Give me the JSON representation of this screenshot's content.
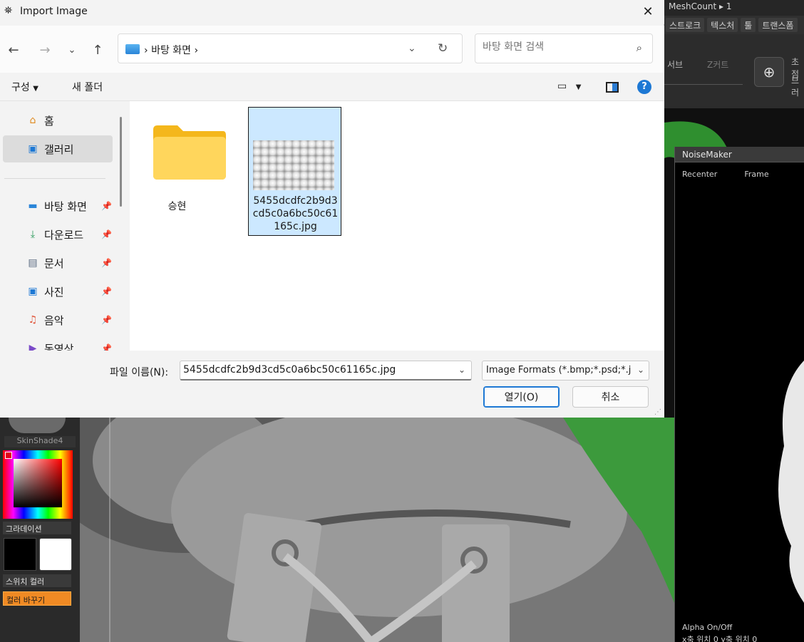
{
  "dialog": {
    "title": "Import Image",
    "address": {
      "path": "바탕 화면"
    },
    "search": {
      "placeholder": "바탕 화면 검색"
    },
    "commandbar": {
      "organize": "구성",
      "new_folder": "새 폴더"
    },
    "sidebar": {
      "top_items": [
        {
          "label": "홈",
          "icon": "home-icon"
        },
        {
          "label": "갤러리",
          "icon": "gallery-icon"
        }
      ],
      "pinned_items": [
        {
          "label": "바탕 화면",
          "icon": "desktop-icon"
        },
        {
          "label": "다운로드",
          "icon": "download-icon"
        },
        {
          "label": "문서",
          "icon": "document-icon"
        },
        {
          "label": "사진",
          "icon": "pictures-icon"
        },
        {
          "label": "음악",
          "icon": "music-icon"
        },
        {
          "label": "동영상",
          "icon": "video-icon"
        }
      ]
    },
    "files": [
      {
        "name": "승현",
        "type": "folder"
      },
      {
        "name": "5455dcdfc2b9d3cd5c0a6bc50c61165c.jpg",
        "type": "image"
      }
    ],
    "footer": {
      "filename_label": "파일 이름(N):",
      "filename_value": "5455dcdfc2b9d3cd5c0a6bc50c61165c.jpg",
      "filter": "Image Formats (*.bmp;*.psd;*.j",
      "open_label": "열기(O)",
      "cancel_label": "취소"
    }
  },
  "background_app": {
    "topbar": "MeshCount ▸ 1",
    "menus": [
      "스트로크",
      "텍스처",
      "툴",
      "트랜스폼"
    ],
    "tool_labels": [
      "서브",
      "Z커트",
      "초점",
      "브러"
    ],
    "noisemaker": {
      "title": "NoiseMaker",
      "recenter": "Recenter",
      "frame": "Frame",
      "alpha": "Alpha On/Off",
      "pos": "x축 위치 0     y축 위치 0"
    },
    "left_panel": {
      "matcap": "SkinShade4",
      "gradient": "그라데이션",
      "switch_color": "스위치 컬러",
      "change_color": "컬러 바꾸기"
    }
  }
}
